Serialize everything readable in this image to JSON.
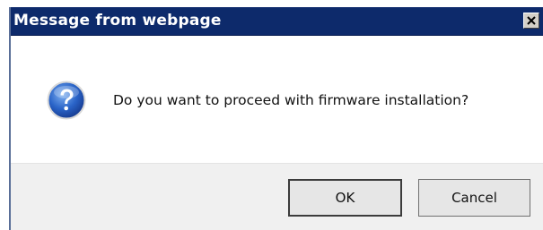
{
  "dialog": {
    "title": "Message from webpage",
    "message": "Do you want to proceed with firmware installation?",
    "icon": "question-icon",
    "buttons": {
      "ok_label": "OK",
      "cancel_label": "Cancel"
    },
    "colors": {
      "titlebar": "#0d2a6b",
      "footer": "#f0f0f0"
    }
  }
}
